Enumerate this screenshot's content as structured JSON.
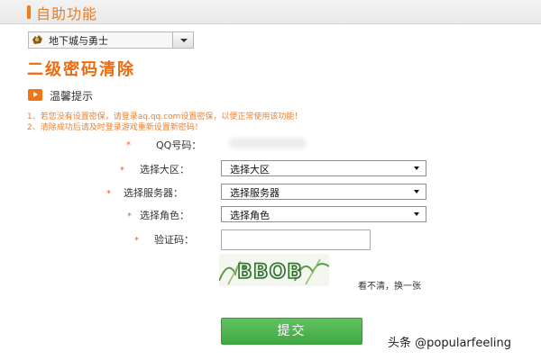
{
  "header": {
    "title": "自助功能"
  },
  "game_selector": {
    "value": "地下城与勇士"
  },
  "section": {
    "title": "二级密码清除"
  },
  "tips": {
    "title": "温馨提示",
    "lines": [
      "1、若您没有设置密保，请登录aq.qq.com设置密保，以便正常使用该功能！",
      "2、清除成功后请及时登录游戏重新设置新密码！"
    ]
  },
  "form": {
    "star": "*",
    "qq_label": "QQ号码：",
    "region_label": "选择大区：",
    "region_value": "选择大区",
    "server_label": "选择服务器：",
    "server_value": "选择服务器",
    "role_label": "选择角色：",
    "role_value": "选择角色",
    "captcha_label": "验证码：",
    "captcha_text": "BBOB",
    "refresh_text": "看不清，换一张",
    "submit_label": "提交"
  },
  "watermark": "头条 @popularfeeling",
  "colors": {
    "accent": "#f07c1d",
    "title": "#ee6b10",
    "tip": "#ef7f2a",
    "submit": "#4fb650"
  }
}
